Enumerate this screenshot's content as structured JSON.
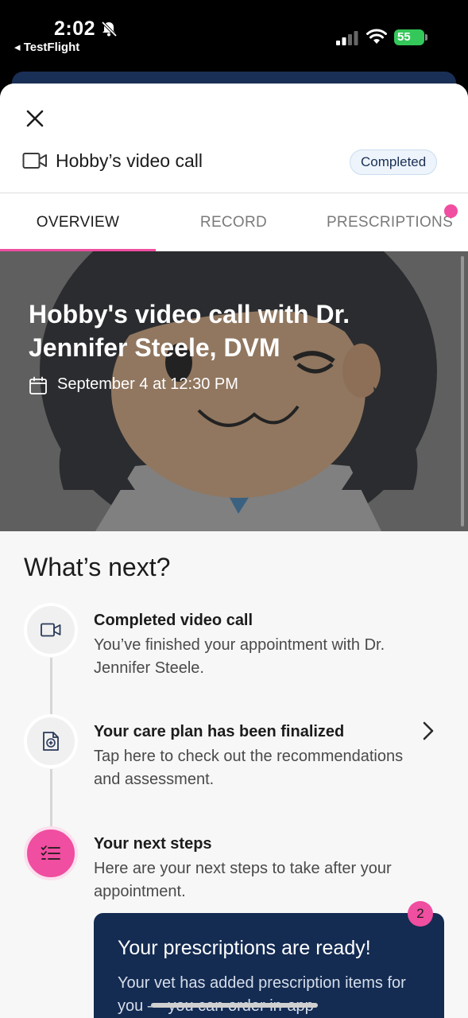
{
  "status_bar": {
    "time": "2:02",
    "back_app": "◂ TestFlight",
    "battery": "55"
  },
  "header": {
    "title": "Hobby’s video call",
    "status": "Completed"
  },
  "tabs": [
    {
      "label": "OVERVIEW",
      "active": true
    },
    {
      "label": "RECORD",
      "active": false
    },
    {
      "label": "PRESCRIPTIONS",
      "active": false,
      "has_notification": true
    }
  ],
  "hero": {
    "title": "Hobby's video call with Dr. Jennifer Steele, DVM",
    "date": "September 4 at 12:30 PM"
  },
  "whats_next": {
    "title": "What’s next?",
    "steps": [
      {
        "title": "Completed video call",
        "description": "You’ve finished your appointment with Dr. Jennifer Steele.",
        "icon": "video-camera-icon"
      },
      {
        "title": "Your care plan has been finalized",
        "description": "Tap here to check out the recommendations and assessment.",
        "icon": "medical-document-icon"
      },
      {
        "title": "Your next steps",
        "description": "Here are your next steps to take after your appointment.",
        "icon": "checklist-icon"
      }
    ]
  },
  "prescription_card": {
    "title": "Your prescriptions are ready!",
    "description": "Your vet has added prescription items for you — you can order in-app",
    "badge_count": "2"
  },
  "colors": {
    "accent": "#f04ea0",
    "navy": "#142b52"
  }
}
